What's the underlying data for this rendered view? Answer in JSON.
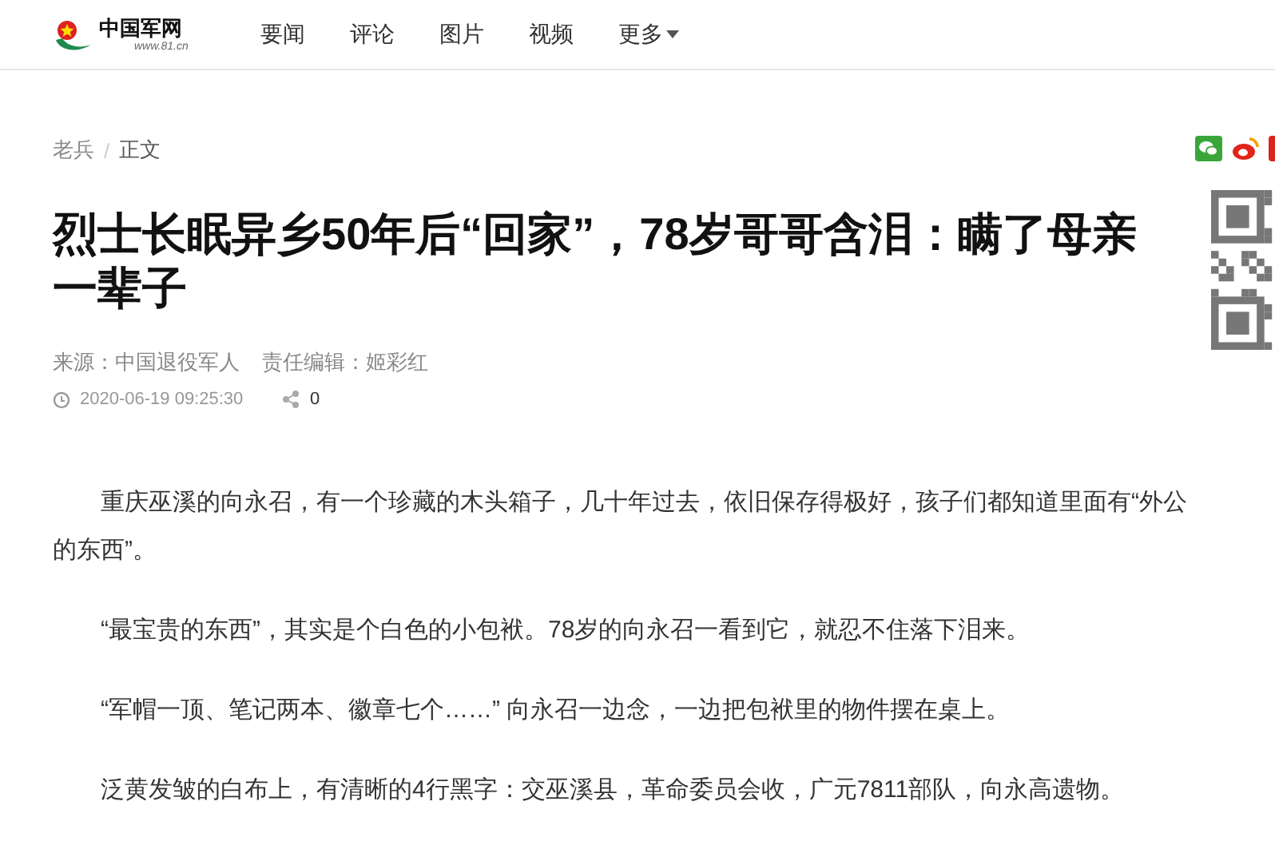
{
  "header": {
    "logo_text": "中国军网",
    "logo_url": "www.81.cn",
    "nav": [
      {
        "label": "要闻",
        "kind": "link"
      },
      {
        "label": "评论",
        "kind": "link"
      },
      {
        "label": "图片",
        "kind": "link"
      },
      {
        "label": "视频",
        "kind": "link"
      },
      {
        "label": "更多",
        "kind": "dropdown"
      }
    ]
  },
  "breadcrumb": {
    "items": [
      "老兵",
      "正文"
    ],
    "separator": "/"
  },
  "article": {
    "title": "烈士长眠异乡50年后“回家”，78岁哥哥含泪：瞒了母亲一辈子",
    "source": "来源：中国退役军人",
    "editor": "责任编辑：姬彩红",
    "date": "2020-06-19 09:25:30",
    "share_count": "0",
    "paragraphs": [
      {
        "lines": [
          "重庆巫溪的向永召，有一个珍藏的木头箱子，几十年过去，依旧保存得极好，孩子们都知道里面有“外公",
          "的东西”。"
        ]
      },
      {
        "lines": [
          "“最宝贵的东西”，其实是个白色的小包袱。78岁的向永召一看到它，就忍不住落下泪来。"
        ]
      },
      {
        "lines": [
          "“军帽一顶、笔记两本、徽章七个……” 向永召一边念，一边把包袱里的物件摆在桌上。"
        ]
      },
      {
        "lines": [
          "泛黄发皱的白布上，有清晰的4行黑字：交巫溪县，革命委员会收，广元7811部队，向永高遗物。"
        ]
      }
    ]
  }
}
